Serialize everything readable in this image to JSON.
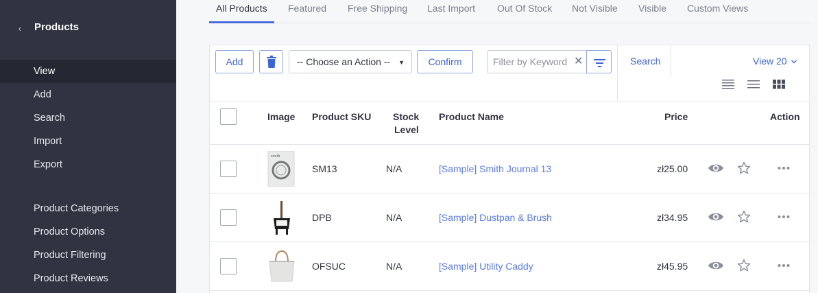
{
  "sidebar": {
    "title": "Products",
    "nav_primary": [
      "View",
      "Add",
      "Search",
      "Import",
      "Export"
    ],
    "nav_secondary": [
      "Product Categories",
      "Product Options",
      "Product Filtering",
      "Product Reviews"
    ],
    "active_item": "View"
  },
  "tabs": [
    "All Products",
    "Featured",
    "Free Shipping",
    "Last Import",
    "Out Of Stock",
    "Not Visible",
    "Visible",
    "Custom Views"
  ],
  "active_tab": "All Products",
  "toolbar": {
    "add_label": "Add",
    "action_select": "-- Choose an Action --",
    "confirm_label": "Confirm",
    "filter_placeholder": "Filter by Keyword",
    "search_label": "Search",
    "view_label": "View 20"
  },
  "table": {
    "headers": {
      "image": "Image",
      "sku": "Product SKU",
      "stock_line1": "Stock",
      "stock_line2": "Level",
      "name": "Product Name",
      "price": "Price",
      "action": "Action"
    },
    "rows": [
      {
        "sku": "SM13",
        "stock": "N/A",
        "name": "[Sample] Smith Journal 13",
        "price": "zł25.00",
        "image": "journal"
      },
      {
        "sku": "DPB",
        "stock": "N/A",
        "name": "[Sample] Dustpan & Brush",
        "price": "zł34.95",
        "image": "dustpan"
      },
      {
        "sku": "OFSUC",
        "stock": "N/A",
        "name": "[Sample] Utility Caddy",
        "price": "zł45.95",
        "image": "caddy"
      }
    ]
  },
  "icons": {
    "back": "chevron-left-icon",
    "delete": "trash-icon",
    "clear": "close-icon",
    "filter": "filter-icon",
    "view_caret": "chevron-down-icon",
    "density": [
      "list-compact-icon",
      "list-icon",
      "grid-icon"
    ],
    "row_actions": [
      "eye-icon",
      "star-icon",
      "more-icon"
    ]
  },
  "colors": {
    "sidebar_bg": "#313440",
    "sidebar_active": "#252833",
    "accent": "#3c64d4",
    "link": "#5a7ae0"
  }
}
